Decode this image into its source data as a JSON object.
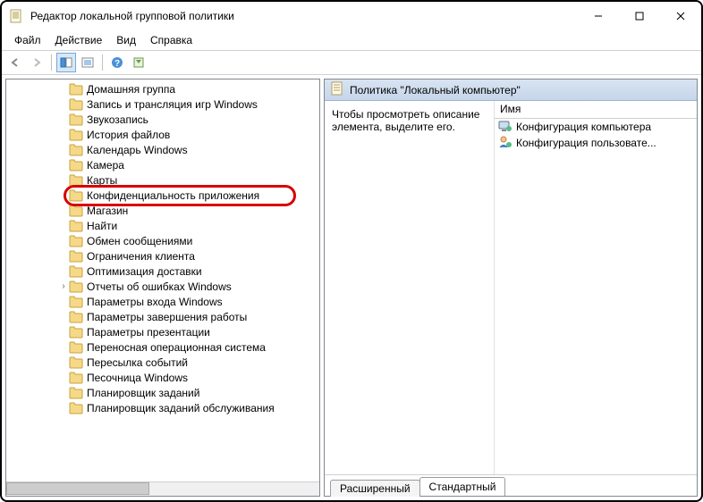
{
  "window": {
    "title": "Редактор локальной групповой политики"
  },
  "menu": {
    "file": "Файл",
    "action": "Действие",
    "view": "Вид",
    "help": "Справка"
  },
  "tree": {
    "items": [
      {
        "label": "Домашняя группа"
      },
      {
        "label": "Запись и трансляция игр Windows"
      },
      {
        "label": "Звукозапись"
      },
      {
        "label": "История файлов"
      },
      {
        "label": "Календарь Windows"
      },
      {
        "label": "Камера"
      },
      {
        "label": "Карты"
      },
      {
        "label": "Конфиденциальность приложения",
        "highlight": true
      },
      {
        "label": "Магазин"
      },
      {
        "label": "Найти"
      },
      {
        "label": "Обмен сообщениями"
      },
      {
        "label": "Ограничения клиента"
      },
      {
        "label": "Оптимизация доставки"
      },
      {
        "label": "Отчеты об ошибках Windows",
        "expandable": true
      },
      {
        "label": "Параметры входа Windows"
      },
      {
        "label": "Параметры завершения работы"
      },
      {
        "label": "Параметры презентации"
      },
      {
        "label": "Переносная операционная система"
      },
      {
        "label": "Пересылка событий"
      },
      {
        "label": "Песочница Windows"
      },
      {
        "label": "Планировщик заданий"
      },
      {
        "label": "Планировщик заданий обслуживания"
      }
    ]
  },
  "right": {
    "header": "Политика \"Локальный компьютер\"",
    "description": "Чтобы просмотреть описание элемента, выделите его.",
    "list_header": "Имя",
    "items": [
      {
        "label": "Конфигурация компьютера"
      },
      {
        "label": "Конфигурация пользовате..."
      }
    ],
    "tabs": {
      "extended": "Расширенный",
      "standard": "Стандартный"
    }
  }
}
